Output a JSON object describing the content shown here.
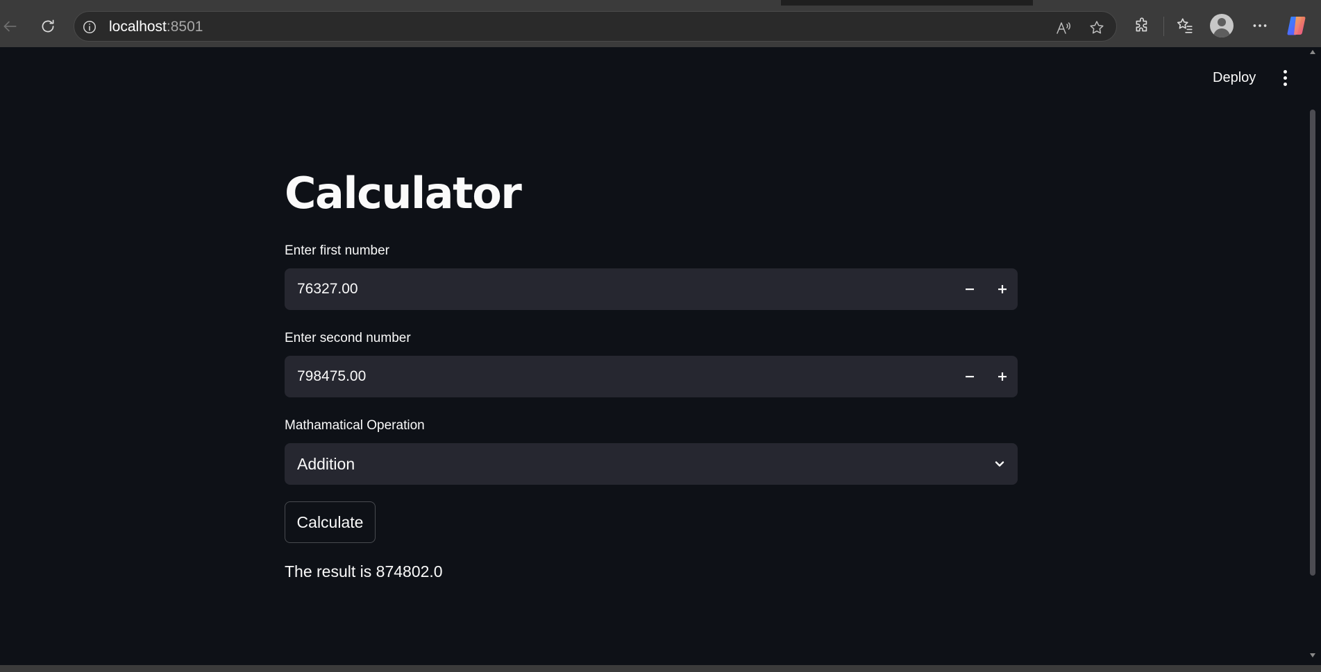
{
  "browser": {
    "url_host": "localhost",
    "url_port": ":8501",
    "icons": {
      "back": "arrow-left-icon",
      "refresh": "refresh-icon",
      "info": "info-icon",
      "read_aloud": "read-aloud-icon",
      "favorite": "star-icon",
      "extensions": "puzzle-icon",
      "favorites": "favorites-icon",
      "profile": "avatar",
      "more": "ellipsis-icon",
      "copilot": "copilot-icon"
    }
  },
  "app": {
    "toolbar": {
      "deploy_label": "Deploy",
      "menu_icon": "kebab-menu-icon"
    },
    "title": "Calculator",
    "first_number": {
      "label": "Enter first number",
      "value": "76327.00"
    },
    "second_number": {
      "label": "Enter second number",
      "value": "798475.00"
    },
    "operation": {
      "label": "Mathamatical Operation",
      "selected": "Addition"
    },
    "calculate_label": "Calculate",
    "result_text": "The result is 874802.0"
  },
  "colors": {
    "background": "#0e1117",
    "input_background": "#262730",
    "text": "#fafafa",
    "browser_chrome": "#3b3b3b"
  }
}
